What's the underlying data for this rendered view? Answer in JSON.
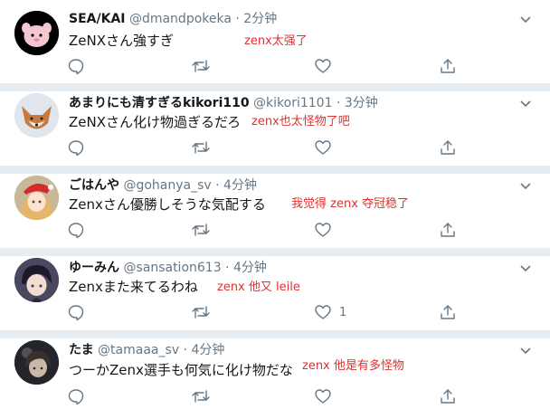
{
  "tweets": [
    {
      "name": "SEA/KAI",
      "handle": "@dmandpokeka",
      "separator": "·",
      "time": "2分钟",
      "text": "ZeNXさん強すぎ",
      "annotation": "zenx太强了",
      "like_count": "",
      "avatar": "pink-creature-avatar"
    },
    {
      "name": "あまりにも清すぎるkikori110",
      "handle": "@kikori1101",
      "separator": "·",
      "time": "3分钟",
      "text": "ZeNXさん化け物過ぎるだろ",
      "annotation": "zenx也太怪物了吧",
      "like_count": "",
      "avatar": "fox-avatar"
    },
    {
      "name": "ごはんや",
      "handle": "@gohanya_sv",
      "separator": "·",
      "time": "4分钟",
      "text": "Zenxさん優勝しそうな気配する",
      "annotation": "我觉得 zenx 夺冠稳了",
      "like_count": "",
      "avatar": "santa-girl-avatar"
    },
    {
      "name": "ゆーみん",
      "handle": "@sansation613",
      "separator": "·",
      "time": "4分钟",
      "text": "Zenxまた来てるわね",
      "annotation": "zenx 他又 leile",
      "like_count": "1",
      "avatar": "dark-hair-anime-avatar"
    },
    {
      "name": "たま",
      "handle": "@tamaaa_sv",
      "separator": "·",
      "time": "4分钟",
      "text": "つーかZenx選手も何気に化け物だな",
      "annotation": "zenx 他是有多怪物",
      "like_count": "",
      "avatar": "dark-anime-avatar"
    }
  ],
  "colors": {
    "name": "#14171a",
    "meta": "#657786",
    "icon": "#657786",
    "annotation": "#e0302f",
    "separator": "#e6ecf0"
  }
}
